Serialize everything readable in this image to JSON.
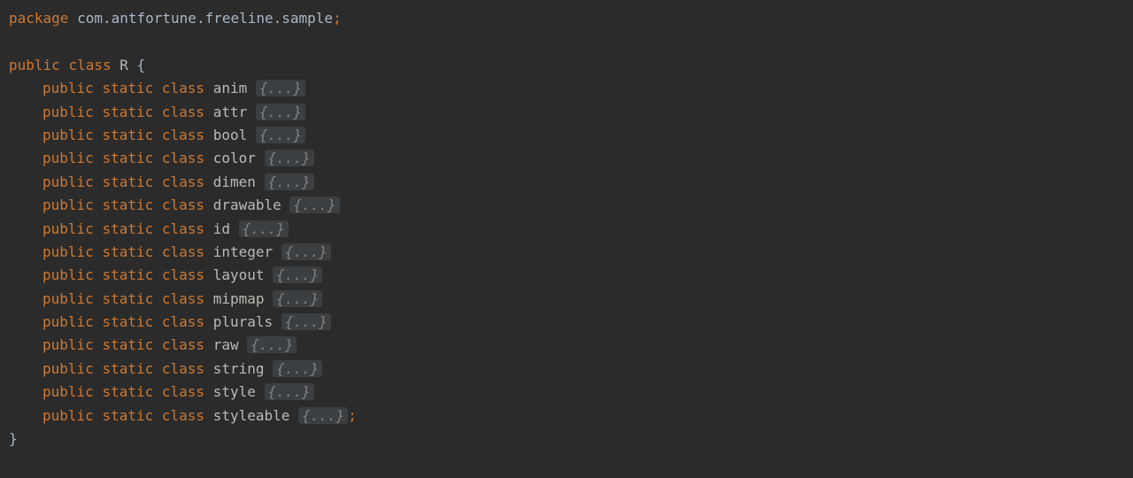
{
  "keywords": {
    "package": "package",
    "public": "public",
    "static": "static",
    "class": "class"
  },
  "packageName": "com.antfortune.freeline.sample",
  "className": "R",
  "openBrace": "{",
  "closeBrace": "}",
  "folded": "{...}",
  "semicolon": ";",
  "innerClasses": [
    "anim",
    "attr",
    "bool",
    "color",
    "dimen",
    "drawable",
    "id",
    "integer",
    "layout",
    "mipmap",
    "plurals",
    "raw",
    "string",
    "style",
    "styleable"
  ],
  "lastHasSemicolon": true
}
